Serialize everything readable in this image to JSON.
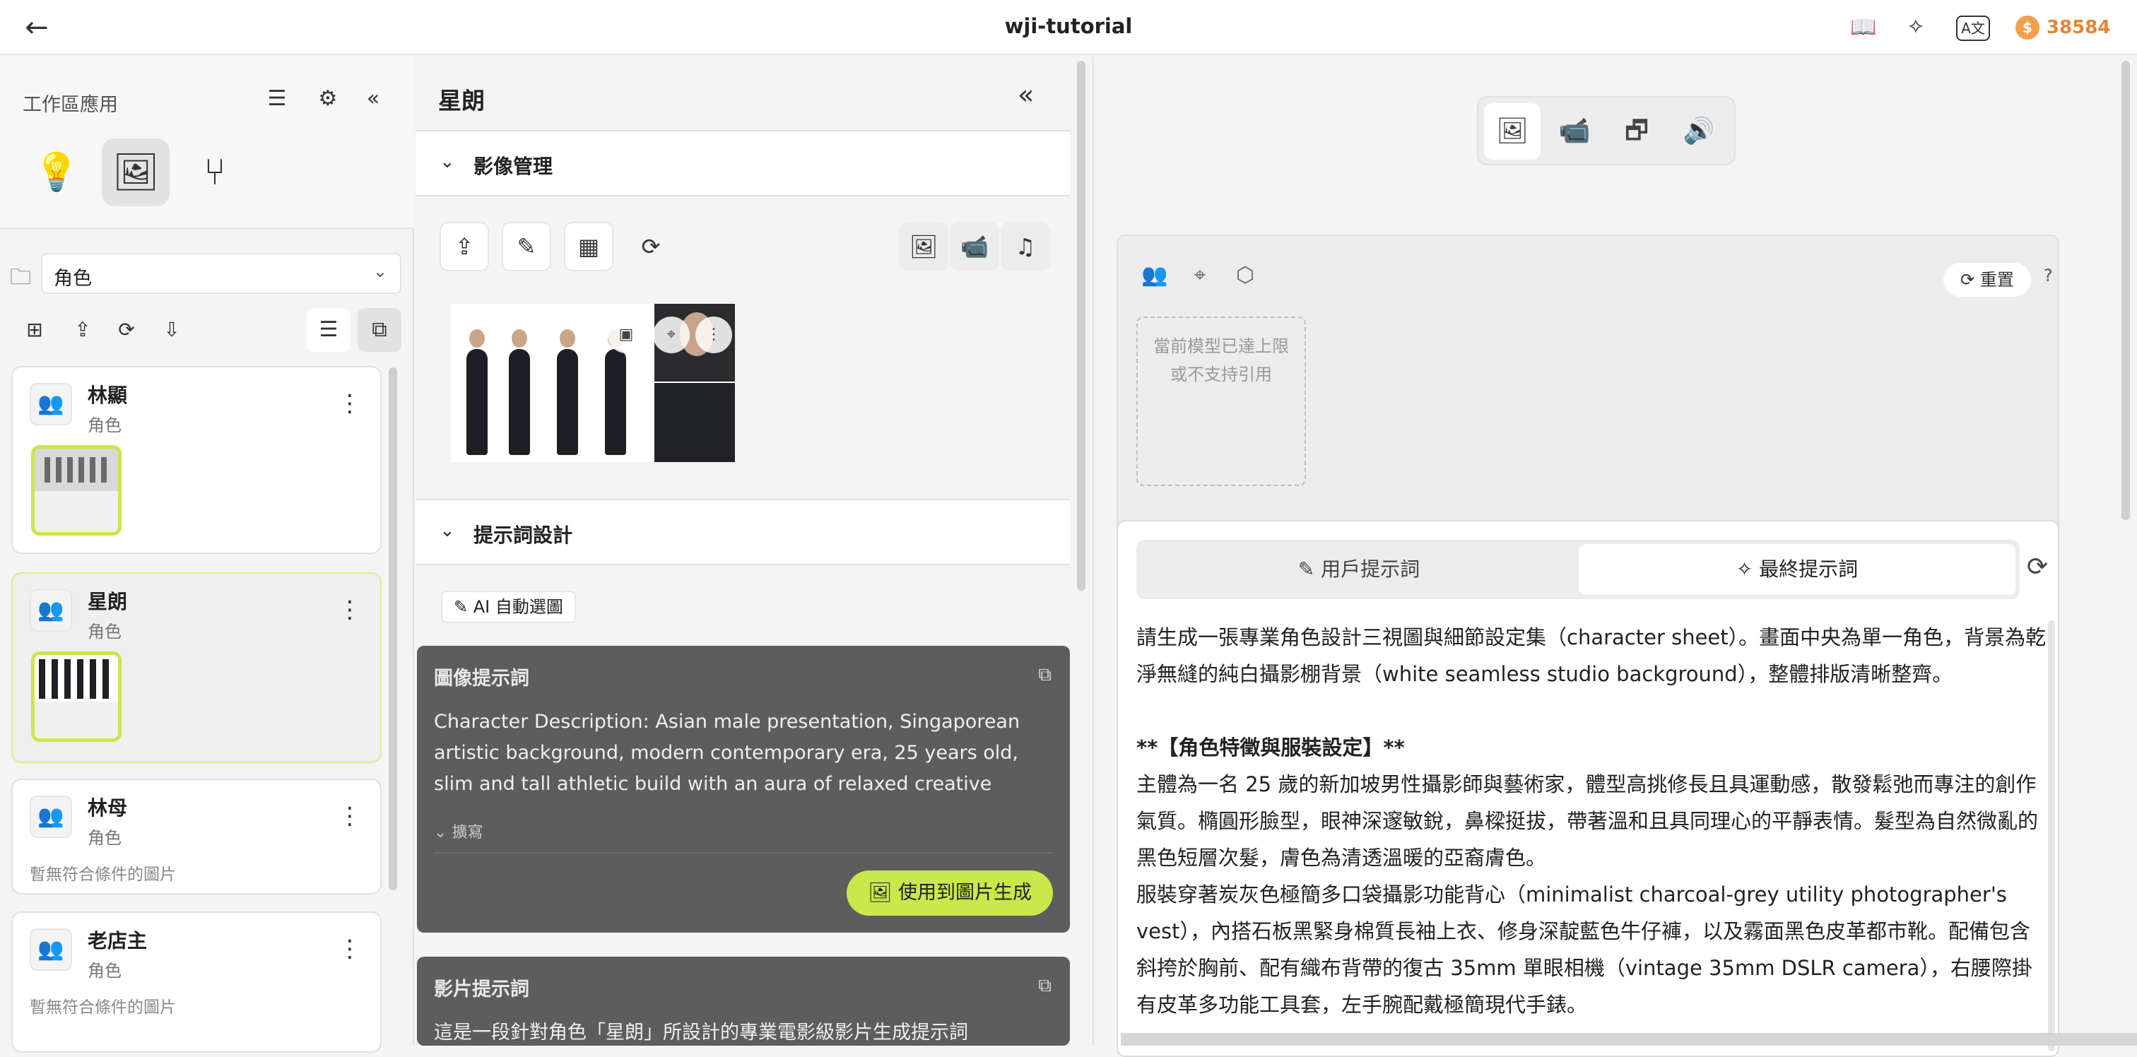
{
  "header": {
    "title": "wji-tutorial",
    "coins": "38584",
    "coin_symbol": "$"
  },
  "left": {
    "title": "工作區應用",
    "folder_select": "角色",
    "characters": [
      {
        "name": "林顯",
        "role": "角色",
        "empty": ""
      },
      {
        "name": "星朗",
        "role": "角色",
        "empty": ""
      },
      {
        "name": "林母",
        "role": "角色",
        "empty": "暫無符合條件的圖片"
      },
      {
        "name": "老店主",
        "role": "角色",
        "empty": "暫無符合條件的圖片"
      }
    ]
  },
  "middle": {
    "title": "星朗",
    "image_section": "影像管理",
    "prompt_section": "提示詞設計",
    "ai_button": "AI 自動選圖",
    "image_prompt": {
      "heading": "圖像提示詞",
      "body": "Character Description: Asian male presentation, Singaporean artistic background, modern contemporary era, 25 years old, slim and tall athletic build with an aura of relaxed creative composure…",
      "expand": "擴寫",
      "use_button": "使用到圖片生成"
    },
    "video_prompt": {
      "heading": "影片提示詞",
      "body": "這是一段針對角色「星朗」所設計的專業電影級影片生成提示詞"
    }
  },
  "right": {
    "reset": "重置",
    "help": "?",
    "ref_notice_1": "當前模型已達上限",
    "ref_notice_2": "或不支持引用",
    "tab_user": "用戶提示詞",
    "tab_final": "最終提示詞",
    "prompt": {
      "p1": "請生成一張專業角色設計三視圖與細節設定集（character sheet）。畫面中央為單一角色，背景為乾淨無縫的純白攝影棚背景（white seamless studio background），整體排版清晰整齊。",
      "p2": "**【角色特徵與服裝設定】**",
      "p3": "主體為一名 25 歲的新加坡男性攝影師與藝術家，體型高挑修長且具運動感，散發鬆弛而專注的創作氣質。橢圓形臉型，眼神深邃敏銳，鼻樑挺拔，帶著溫和且具同理心的平靜表情。髮型為自然微亂的黑色短層次髮，膚色為清透溫暖的亞裔膚色。",
      "p4": "服裝穿著炭灰色極簡多口袋攝影功能背心（minimalist charcoal-grey utility photographer's vest），內搭石板黑緊身棉質長袖上衣、修身深靛藍色牛仔褲，以及霧面黑色皮革都市靴。配備包含斜挎於胸前、配有織布背帶的復古 35mm 單眼相機（vintage 35mm DSLR camera），右腰際掛有皮革多功能工具套，左手腕配戴極簡現代手錶。"
    }
  }
}
